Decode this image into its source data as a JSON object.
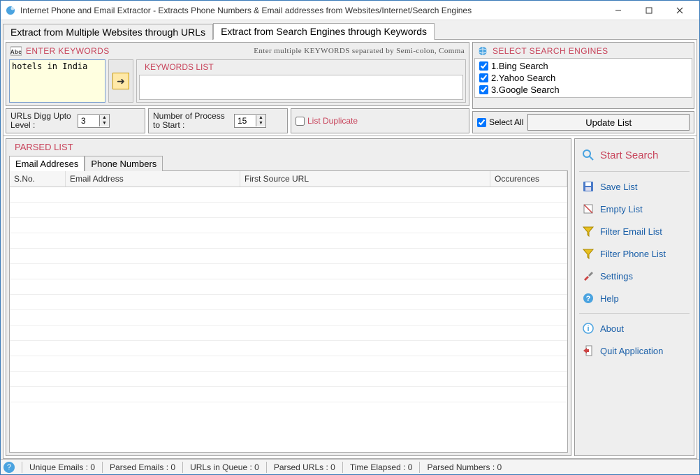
{
  "window": {
    "title": "Internet Phone and Email Extractor - Extracts Phone Numbers & Email addresses from Websites/Internet/Search Engines"
  },
  "tabs": {
    "urls": "Extract from Multiple Websites through URLs",
    "keywords": "Extract from Search Engines through Keywords"
  },
  "keywords_panel": {
    "title": "ENTER KEYWORDS",
    "hint": "Enter multiple KEYWORDS separated by Semi-colon, Comma",
    "input_value": "hotels in India",
    "list_title": "KEYWORDS LIST"
  },
  "options": {
    "digg_label": "URLs Digg Upto Level :",
    "digg_value": "3",
    "process_label": "Number of Process to Start :",
    "process_value": "15",
    "list_duplicate": "List Duplicate"
  },
  "search_engines": {
    "title": "SELECT SEARCH ENGINES",
    "items": [
      "1.Bing Search",
      "2.Yahoo Search",
      "3.Google Search"
    ],
    "select_all": "Select All",
    "update": "Update List"
  },
  "parsed": {
    "title": "PARSED LIST",
    "sub_tabs": {
      "emails": "Email Addreses",
      "phones": "Phone Numbers"
    },
    "columns": {
      "sno": "S.No.",
      "email": "Email Address",
      "url": "First Source URL",
      "occ": "Occurences"
    }
  },
  "actions": {
    "start": "Start Search",
    "save": "Save List",
    "empty": "Empty List",
    "filter_email": "Filter Email List",
    "filter_phone": "Filter Phone List",
    "settings": "Settings",
    "help": "Help",
    "about": "About",
    "quit": "Quit Application"
  },
  "status": {
    "unique_emails": "Unique Emails :  0",
    "parsed_emails": "Parsed Emails :  0",
    "urls_queue": "URLs in Queue :  0",
    "parsed_urls": "Parsed URLs :  0",
    "time": "Time Elapsed :  0",
    "parsed_numbers": "Parsed Numbers :   0"
  }
}
